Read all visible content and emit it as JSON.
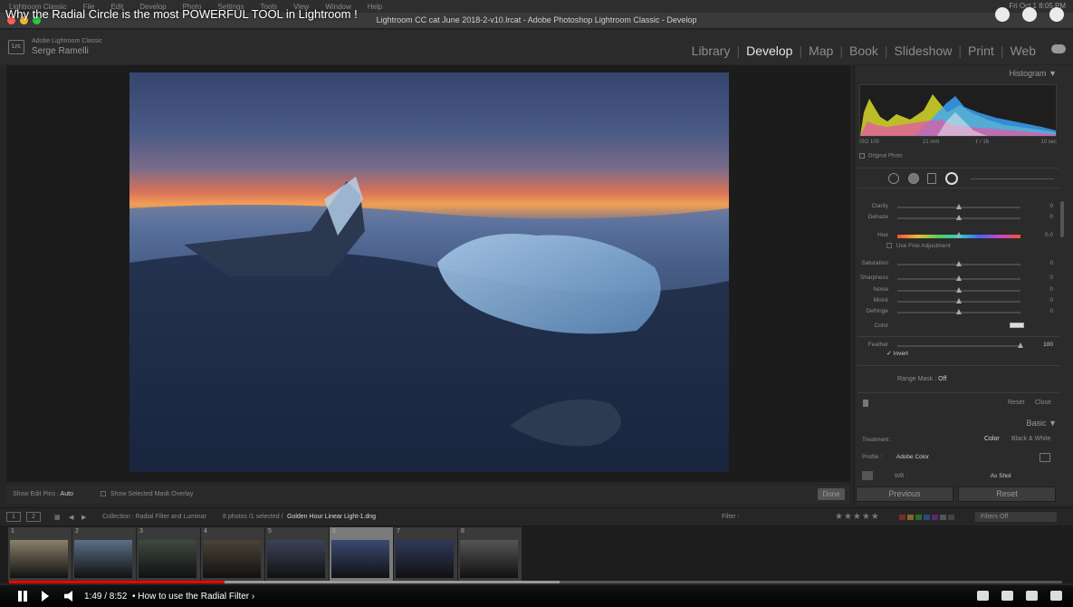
{
  "video": {
    "title": "Why the Radial Circle is the most POWERFUL TOOL in Lightroom !",
    "time": "1:49 / 8:52",
    "chapter": "• How to use the Radial Filter ›",
    "progress": 0.205
  },
  "menubar": {
    "items": [
      "Lightroom Classic",
      "File",
      "Edit",
      "Develop",
      "Photo",
      "Settings",
      "Tools",
      "View",
      "Window",
      "Help"
    ],
    "clock": "Fri Oct 1 8:05 PM"
  },
  "window": {
    "title": "Lightroom CC cat June 2018-2-v10.lrcat - Adobe Photoshop Lightroom Classic - Develop"
  },
  "identity": {
    "logo": "Lrc",
    "app": "Adobe Lightroom Classic",
    "user": "Serge Ramelli"
  },
  "modules": [
    "Library",
    "Develop",
    "Map",
    "Book",
    "Slideshow",
    "Print",
    "Web"
  ],
  "active_module": "Develop",
  "histogram": {
    "header": "Histogram",
    "iso": "ISO 100",
    "focal": "21 mm",
    "aperture": "ƒ / 16",
    "shutter": "10 sec",
    "original_photo": "Original Photo"
  },
  "mask_panel": {
    "sliders": [
      {
        "label": "Clarity",
        "value": "0",
        "pos": 0.5
      },
      {
        "label": "Dehaze",
        "value": "0",
        "pos": 0.5
      },
      {
        "label": "Hue",
        "value": "0.0",
        "pos": 0.5
      },
      {
        "label": "Saturation",
        "value": "0",
        "pos": 0.5
      },
      {
        "label": "Sharpness",
        "value": "0",
        "pos": 0.5
      },
      {
        "label": "Noise",
        "value": "0",
        "pos": 0.5
      },
      {
        "label": "Moiré",
        "value": "0",
        "pos": 0.5
      },
      {
        "label": "Defringe",
        "value": "0",
        "pos": 0.5
      }
    ],
    "use_fine_adjustment": "Use Fine Adjustment",
    "color_label": "Color",
    "feather_label": "Feather",
    "feather_value": "100",
    "feather_pos": 1.0,
    "invert_label": "Invert",
    "range_mask_label": "Range Mask :",
    "range_mask_value": "Off",
    "reset": "Reset",
    "close": "Close"
  },
  "basic": {
    "header": "Basic",
    "treatment_label": "Treatment :",
    "treatment_color": "Color",
    "treatment_bw": "Black & White",
    "profile_label": "Profile :",
    "profile_value": "Adobe Color",
    "wb_label": "WB :",
    "wb_value": "As Shot"
  },
  "bottom_buttons": {
    "previous": "Previous",
    "reset": "Reset"
  },
  "toolbar": {
    "show_edit_pins": "Show Edit Pins :",
    "pins_value": "Auto",
    "show_mask_overlay": "Show Selected Mask Overlay",
    "done": "Done"
  },
  "filmstrip_bar": {
    "page1": "1",
    "page2": "2",
    "collection": "Collection : Radial Filter and Luminar",
    "count": "8 photos /1 selected /",
    "filename": "Golden Hour Linear Light-1.dng",
    "filter_label": "Filter :",
    "filters_off": "Filters Off"
  },
  "filmstrip": [
    {
      "num": "1",
      "color": "#8a7f6a"
    },
    {
      "num": "2",
      "color": "#5a6f88"
    },
    {
      "num": "3",
      "color": "#3e4a40"
    },
    {
      "num": "4",
      "color": "#4a4438"
    },
    {
      "num": "5",
      "color": "#3a4458"
    },
    {
      "num": "6",
      "color": "#3a4a72"
    },
    {
      "num": "7",
      "color": "#2e3a5a"
    },
    {
      "num": "8",
      "color": "#555555"
    }
  ],
  "colors": {
    "accent": "#e6e6e6",
    "progress_red": "#ee0000",
    "panel_bg": "#2b2b2b"
  }
}
